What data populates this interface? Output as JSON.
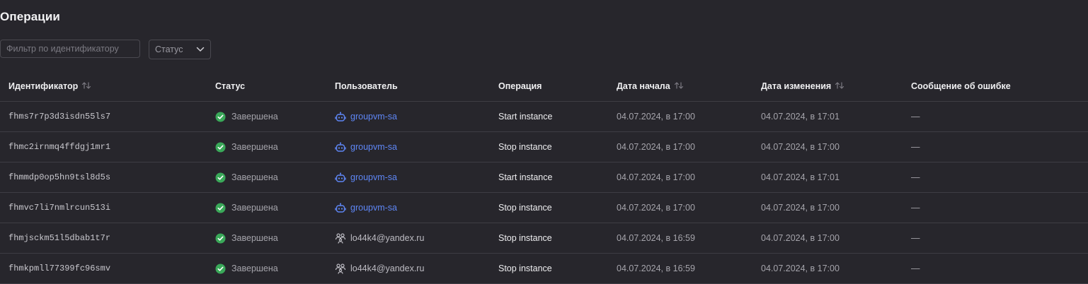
{
  "page": {
    "title": "Операции"
  },
  "filters": {
    "id_placeholder": "Фильтр по идентификатору",
    "status_label": "Статус"
  },
  "colors": {
    "success": "#3aa859",
    "link": "#5e86f5",
    "background": "#27262c"
  },
  "table": {
    "headers": {
      "id": "Идентификатор",
      "status": "Статус",
      "user": "Пользователь",
      "operation": "Операция",
      "start_date": "Дата начала",
      "modified_date": "Дата изменения",
      "error": "Сообщение об ошибке"
    },
    "rows": [
      {
        "id": "fhms7r7p3d3isdn55ls7",
        "status": "Завершена",
        "user": "groupvm-sa",
        "user_icon": "robot-icon",
        "operation": "Start instance",
        "start": "04.07.2024, в 17:00",
        "modified": "04.07.2024, в 17:01",
        "error": "—"
      },
      {
        "id": "fhmc2irnmq4ffdgj1mr1",
        "status": "Завершена",
        "user": "groupvm-sa",
        "user_icon": "robot-icon",
        "operation": "Stop instance",
        "start": "04.07.2024, в 17:00",
        "modified": "04.07.2024, в 17:00",
        "error": "—"
      },
      {
        "id": "fhmmdp0op5hn9tsl8d5s",
        "status": "Завершена",
        "user": "groupvm-sa",
        "user_icon": "robot-icon",
        "operation": "Start instance",
        "start": "04.07.2024, в 17:00",
        "modified": "04.07.2024, в 17:01",
        "error": "—"
      },
      {
        "id": "fhmvc7li7nmlrcun513i",
        "status": "Завершена",
        "user": "groupvm-sa",
        "user_icon": "robot-icon",
        "operation": "Stop instance",
        "start": "04.07.2024, в 17:00",
        "modified": "04.07.2024, в 17:00",
        "error": "—"
      },
      {
        "id": "fhmjsckm51l5dbab1t7r",
        "status": "Завершена",
        "user": "lo44k4@yandex.ru",
        "user_icon": "user-group-icon",
        "operation": "Stop instance",
        "start": "04.07.2024, в 16:59",
        "modified": "04.07.2024, в 17:00",
        "error": "—"
      },
      {
        "id": "fhmkpmll77399fc96smv",
        "status": "Завершена",
        "user": "lo44k4@yandex.ru",
        "user_icon": "user-group-icon",
        "operation": "Stop instance",
        "start": "04.07.2024, в 16:59",
        "modified": "04.07.2024, в 17:00",
        "error": "—"
      }
    ]
  }
}
